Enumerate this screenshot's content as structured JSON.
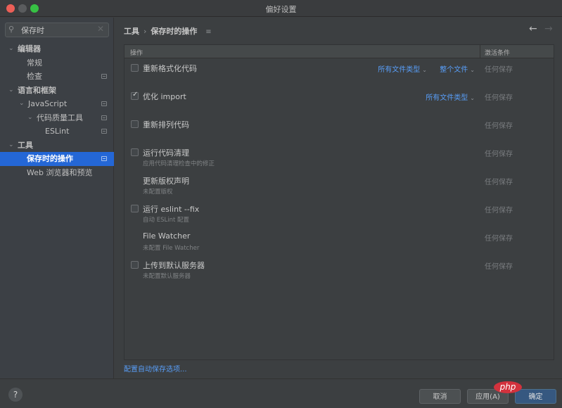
{
  "window": {
    "title": "偏好设置"
  },
  "sidebar": {
    "search": {
      "value": "保存时",
      "icon": "search-icon",
      "clear_icon": "close-icon"
    },
    "items": [
      {
        "label": "编辑器",
        "level": 0,
        "expanded": true,
        "bold": true,
        "project_icon": false,
        "selected": false
      },
      {
        "label": "常规",
        "level": 1,
        "bold": false,
        "project_icon": false,
        "selected": false
      },
      {
        "label": "检查",
        "level": 1,
        "bold": false,
        "project_icon": true,
        "selected": false
      },
      {
        "label": "语言和框架",
        "level": 0,
        "expanded": true,
        "bold": true,
        "project_icon": false,
        "selected": false
      },
      {
        "label": "JavaScript",
        "level": 1,
        "expanded": true,
        "bold": false,
        "project_icon": true,
        "selected": false
      },
      {
        "label": "代码质量工具",
        "level": 2,
        "expanded": true,
        "bold": false,
        "project_icon": true,
        "selected": false
      },
      {
        "label": "ESLint",
        "level": 3,
        "bold": false,
        "project_icon": true,
        "selected": false
      },
      {
        "label": "工具",
        "level": 0,
        "expanded": true,
        "bold": true,
        "project_icon": false,
        "selected": false
      },
      {
        "label": "保存时的操作",
        "level": 1,
        "bold": true,
        "project_icon": true,
        "selected": true
      },
      {
        "label": "Web 浏览器和预览",
        "level": 1,
        "bold": false,
        "project_icon": false,
        "selected": false
      }
    ]
  },
  "main": {
    "breadcrumb": [
      "工具",
      "保存时的操作"
    ],
    "breadcrumb_separator": "›",
    "breadcrumb_menu_icon": "≡",
    "nav": {
      "back": "←",
      "forward": "→"
    },
    "table": {
      "headers": {
        "action": "操作",
        "condition": "激活条件"
      },
      "rows": [
        {
          "title": "重新格式化代码",
          "subtitle": "",
          "has_checkbox": true,
          "checked": false,
          "file_types": "所有文件类型",
          "scope": "整个文件",
          "condition": "任何保存"
        },
        {
          "title": "优化 import",
          "subtitle": "",
          "has_checkbox": true,
          "checked": true,
          "file_types": "所有文件类型",
          "scope": "",
          "condition": "任何保存"
        },
        {
          "title": "重新排列代码",
          "subtitle": "",
          "has_checkbox": true,
          "checked": false,
          "file_types": "",
          "scope": "",
          "condition": "任何保存"
        },
        {
          "title": "运行代码清理",
          "subtitle": "应用代码清理检查中的修正",
          "has_checkbox": true,
          "checked": false,
          "file_types": "",
          "scope": "",
          "condition": "任何保存"
        },
        {
          "title": "更新版权声明",
          "subtitle": "未配置版权",
          "has_checkbox": false,
          "checked": false,
          "file_types": "",
          "scope": "",
          "condition": "任何保存"
        },
        {
          "title": "运行 eslint --fix",
          "subtitle": "自动 ESLint 配置",
          "has_checkbox": true,
          "checked": false,
          "file_types": "",
          "scope": "",
          "condition": "任何保存"
        },
        {
          "title": "File Watcher",
          "subtitle": "未配置 File Watcher",
          "has_checkbox": false,
          "checked": false,
          "file_types": "",
          "scope": "",
          "condition": "任何保存"
        },
        {
          "title": "上传到默认服务器",
          "subtitle": "未配置默认服务器",
          "has_checkbox": true,
          "checked": false,
          "file_types": "",
          "scope": "",
          "condition": "任何保存"
        }
      ]
    },
    "autosave_link": "配置自动保存选项..."
  },
  "footer": {
    "help": "?",
    "cancel": "取消",
    "apply": "应用(A)",
    "ok": "确定",
    "watermark": "php"
  },
  "colors": {
    "accent": "#2467d6",
    "link": "#589df6",
    "ok_button": "#365880"
  }
}
